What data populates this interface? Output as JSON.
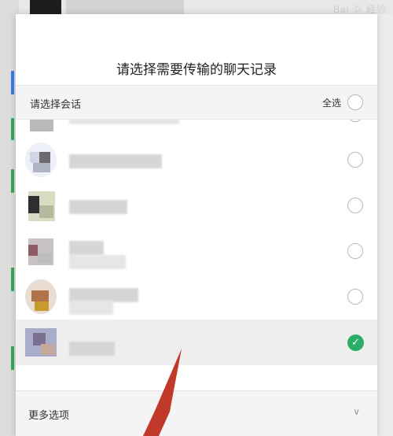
{
  "watermark": "Bai Ⓓ 经验",
  "dialog": {
    "title": "请选择需要传输的聊天记录",
    "section_label": "请选择会话",
    "select_all_label": "全选"
  },
  "conversations": [
    {
      "selected": false
    },
    {
      "selected": false
    },
    {
      "selected": false
    },
    {
      "selected": false
    },
    {
      "selected": false
    },
    {
      "selected": true
    }
  ],
  "footer": {
    "more_options_label": "更多选项",
    "chevron_icon": "chevron-down-icon"
  },
  "colors": {
    "check_green": "#2aae67",
    "annotation_arrow": "#c0392b"
  }
}
